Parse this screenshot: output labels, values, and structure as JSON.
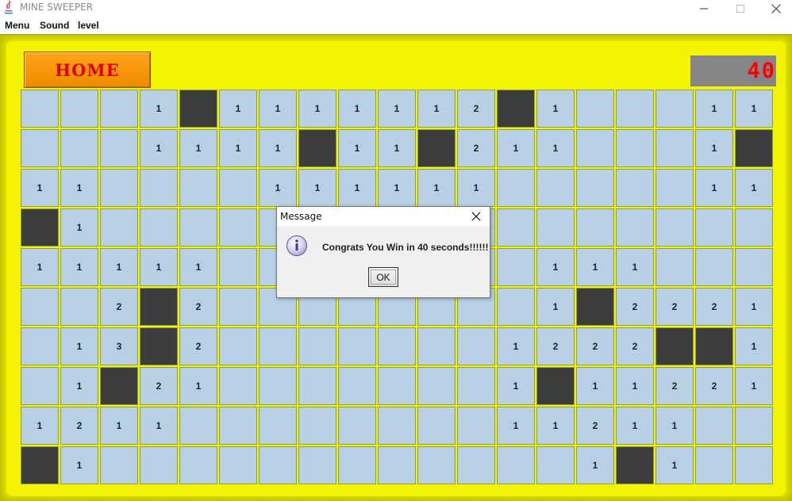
{
  "window": {
    "title": "MINE SWEEPER"
  },
  "menu": {
    "items": [
      "Menu",
      "Sound",
      "level"
    ]
  },
  "home_button": {
    "label": "HOME"
  },
  "timer": {
    "value": "40"
  },
  "board": {
    "rows": 10,
    "cols": 19,
    "cells": [
      [
        "",
        "",
        "",
        "1",
        "M",
        "1",
        "1",
        "1",
        "1",
        "1",
        "1",
        "2",
        "M",
        "1",
        "",
        "",
        "",
        "1",
        "1"
      ],
      [
        "",
        "",
        "",
        "1",
        "1",
        "1",
        "1",
        "M",
        "1",
        "1",
        "M",
        "2",
        "1",
        "1",
        "",
        "",
        "",
        "1",
        "M"
      ],
      [
        "1",
        "1",
        "",
        "",
        "",
        "",
        "1",
        "1",
        "1",
        "1",
        "1",
        "1",
        "",
        "",
        "",
        "",
        "",
        "1",
        "1"
      ],
      [
        "M",
        "1",
        "",
        "",
        "",
        "",
        "",
        "",
        "",
        "",
        "",
        "",
        "",
        "",
        "",
        "",
        "",
        "",
        ""
      ],
      [
        "1",
        "1",
        "1",
        "1",
        "1",
        "",
        "",
        "",
        "",
        "",
        "",
        "",
        "",
        "1",
        "1",
        "1",
        "",
        "",
        ""
      ],
      [
        "",
        "",
        "2",
        "M",
        "2",
        "",
        "",
        "",
        "",
        "",
        "",
        "",
        "",
        "1",
        "M",
        "2",
        "2",
        "2",
        "1"
      ],
      [
        "",
        "1",
        "3",
        "M",
        "2",
        "",
        "",
        "",
        "",
        "",
        "",
        "",
        "1",
        "2",
        "2",
        "2",
        "M",
        "M",
        "1"
      ],
      [
        "",
        "1",
        "M",
        "2",
        "1",
        "",
        "",
        "",
        "",
        "",
        "",
        "",
        "1",
        "M",
        "1",
        "1",
        "2",
        "2",
        "1"
      ],
      [
        "1",
        "2",
        "1",
        "1",
        "",
        "",
        "",
        "",
        "",
        "",
        "",
        "",
        "1",
        "1",
        "2",
        "1",
        "1",
        "",
        ""
      ],
      [
        "M",
        "1",
        "",
        "",
        "",
        "",
        "",
        "",
        "",
        "",
        "",
        "",
        "",
        "",
        "1",
        "M",
        "1",
        "",
        ""
      ]
    ]
  },
  "dialog": {
    "title": "Message",
    "message": "Congrats You Win in 40 seconds!!!!!!",
    "ok_label": "OK",
    "icon": "info-icon"
  },
  "colors": {
    "background_yellow": "#f4f400",
    "cell": "#b8cfe6",
    "mine_cell": "#3d3d3d",
    "home_orange": "#ffa51a",
    "home_text": "#e00000",
    "timer_bg": "#858585",
    "timer_text": "#ff0000"
  }
}
